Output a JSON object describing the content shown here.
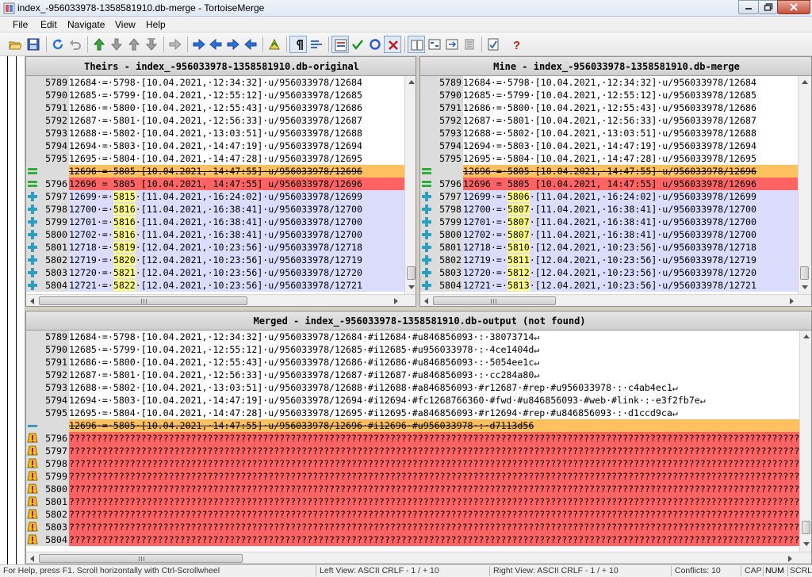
{
  "window": {
    "title": "index_-956033978-1358581910.db-merge - TortoiseMerge"
  },
  "menu": {
    "items": [
      "File",
      "Edit",
      "Navigate",
      "View",
      "Help"
    ]
  },
  "toolbar": {
    "buttons": [
      {
        "name": "open-icon"
      },
      {
        "name": "save-icon"
      },
      {
        "name": "reload-icon"
      },
      {
        "name": "undo-icon"
      },
      {
        "name": "first-difference-icon"
      },
      {
        "name": "next-difference-icon"
      },
      {
        "name": "previous-difference-icon"
      },
      {
        "name": "last-difference-icon"
      },
      {
        "name": "next-inline-difference-icon"
      },
      {
        "name": "next-conflict-icon"
      },
      {
        "name": "previous-conflict-icon"
      },
      {
        "name": "next-edited-icon"
      },
      {
        "name": "previous-edited-icon"
      },
      {
        "name": "filter-icon"
      },
      {
        "name": "whitespace-icon"
      },
      {
        "name": "inline-diff-icon"
      },
      {
        "name": "line-diff-icon"
      },
      {
        "name": "mark-resolved-icon"
      },
      {
        "name": "use-block-icon"
      },
      {
        "name": "reject-icon"
      },
      {
        "name": "one-pane-view-icon"
      },
      {
        "name": "two-pane-view-icon"
      },
      {
        "name": "three-pane-view-icon"
      },
      {
        "name": "collapse-icon"
      },
      {
        "name": "settings-icon"
      },
      {
        "name": "help-icon"
      }
    ]
  },
  "colors": {
    "conflict": "#ff6363",
    "resolved": "#ffc060",
    "added": "#dcdcff",
    "highlight": "#ffff80",
    "linenum_bg": "#dcdcdc"
  },
  "panes": {
    "theirs": {
      "header": "Theirs - index_-956033978-1358581910.db-original",
      "rows": [
        {
          "style": "normal",
          "icon": "",
          "num": "5789",
          "text": "12684·=·5798·[10.04.2021,·12:34:32]·u/956033978/12684"
        },
        {
          "style": "normal",
          "icon": "",
          "num": "5790",
          "text": "12685·=·5799·[10.04.2021,·12:55:12]·u/956033978/12685"
        },
        {
          "style": "normal",
          "icon": "",
          "num": "5791",
          "text": "12686·=·5800·[10.04.2021,·12:55:43]·u/956033978/12686"
        },
        {
          "style": "normal",
          "icon": "",
          "num": "5792",
          "text": "12687·=·5801·[10.04.2021,·12:56:33]·u/956033978/12687"
        },
        {
          "style": "normal",
          "icon": "",
          "num": "5793",
          "text": "12688·=·5802·[10.04.2021,·13:03:51]·u/956033978/12688"
        },
        {
          "style": "normal",
          "icon": "",
          "num": "5794",
          "text": "12694·=·5803·[10.04.2021,·14:47:19]·u/956033978/12694"
        },
        {
          "style": "normal",
          "icon": "",
          "num": "5795",
          "text": "12695·=·5804·[10.04.2021,·14:47:28]·u/956033978/12695"
        },
        {
          "style": "conflict-res",
          "icon": "equal",
          "num": "",
          "text": "12696·=·5805·[10.04.2021,·14:47:55]·u/956033978/12696"
        },
        {
          "style": "conflict",
          "icon": "equal",
          "num": "5796",
          "text": "12696 = 5805 [10.04.2021, 14:47:55] u/956033978/12696"
        },
        {
          "style": "added",
          "icon": "plus",
          "num": "5797",
          "pre": "12699·=·",
          "hl": "5815",
          "post": "·[11.04.2021,·16:24:02]·u/956033978/12699"
        },
        {
          "style": "added",
          "icon": "plus",
          "num": "5798",
          "pre": "12700·=·",
          "hl": "5816",
          "post": "·[11.04.2021,·16:38:41]·u/956033978/12700"
        },
        {
          "style": "added",
          "icon": "plus",
          "num": "5799",
          "pre": "12701·=·",
          "hl": "5816",
          "post": "·[11.04.2021,·16:38:41]·u/956033978/12700"
        },
        {
          "style": "added",
          "icon": "plus",
          "num": "5800",
          "pre": "12702·=·",
          "hl": "5816",
          "post": "·[11.04.2021,·16:38:41]·u/956033978/12700"
        },
        {
          "style": "added",
          "icon": "plus",
          "num": "5801",
          "pre": "12718·=·",
          "hl": "5819",
          "post": "·[12.04.2021,·10:23:56]·u/956033978/12718"
        },
        {
          "style": "added",
          "icon": "plus",
          "num": "5802",
          "pre": "12719·=·",
          "hl": "5820",
          "post": "·[12.04.2021,·10:23:56]·u/956033978/12719"
        },
        {
          "style": "added",
          "icon": "plus",
          "num": "5803",
          "pre": "12720·=·",
          "hl": "5821",
          "post": "·[12.04.2021,·10:23:56]·u/956033978/12720"
        },
        {
          "style": "added",
          "icon": "plus",
          "num": "5804",
          "pre": "12721·=·",
          "hl": "5822",
          "post": "·[12.04.2021,·10:23:56]·u/956033978/12721"
        }
      ]
    },
    "mine": {
      "header": "Mine - index_-956033978-1358581910.db-merge",
      "rows": [
        {
          "style": "normal",
          "icon": "",
          "num": "5789",
          "text": "12684·=·5798·[10.04.2021,·12:34:32]·u/956033978/12684"
        },
        {
          "style": "normal",
          "icon": "",
          "num": "5790",
          "text": "12685·=·5799·[10.04.2021,·12:55:12]·u/956033978/12685"
        },
        {
          "style": "normal",
          "icon": "",
          "num": "5791",
          "text": "12686·=·5800·[10.04.2021,·12:55:43]·u/956033978/12686"
        },
        {
          "style": "normal",
          "icon": "",
          "num": "5792",
          "text": "12687·=·5801·[10.04.2021,·12:56:33]·u/956033978/12687"
        },
        {
          "style": "normal",
          "icon": "",
          "num": "5793",
          "text": "12688·=·5802·[10.04.2021,·13:03:51]·u/956033978/12688"
        },
        {
          "style": "normal",
          "icon": "",
          "num": "5794",
          "text": "12694·=·5803·[10.04.2021,·14:47:19]·u/956033978/12694"
        },
        {
          "style": "normal",
          "icon": "",
          "num": "5795",
          "text": "12695·=·5804·[10.04.2021,·14:47:28]·u/956033978/12695"
        },
        {
          "style": "conflict-res",
          "icon": "equal",
          "num": "",
          "text": "12696·=·5805·[10.04.2021,·14:47:55]·u/956033978/12696"
        },
        {
          "style": "conflict",
          "icon": "equal",
          "num": "5796",
          "text": "12696 = 5805 [10.04.2021, 14:47:55] u/956033978/12696"
        },
        {
          "style": "added",
          "icon": "plus",
          "num": "5797",
          "pre": "12699·=·",
          "hl": "5806",
          "post": "·[11.04.2021,·16:24:02]·u/956033978/12699"
        },
        {
          "style": "added",
          "icon": "plus",
          "num": "5798",
          "pre": "12700·=·",
          "hl": "5807",
          "post": "·[11.04.2021,·16:38:41]·u/956033978/12700"
        },
        {
          "style": "added",
          "icon": "plus",
          "num": "5799",
          "pre": "12701·=·",
          "hl": "5807",
          "post": "·[11.04.2021,·16:38:41]·u/956033978/12700"
        },
        {
          "style": "added",
          "icon": "plus",
          "num": "5800",
          "pre": "12702·=·",
          "hl": "5807",
          "post": "·[11.04.2021,·16:38:41]·u/956033978/12700"
        },
        {
          "style": "added",
          "icon": "plus",
          "num": "5801",
          "pre": "12718·=·",
          "hl": "5810",
          "post": "·[12.04.2021,·10:23:56]·u/956033978/12718"
        },
        {
          "style": "added",
          "icon": "plus",
          "num": "5802",
          "pre": "12719·=·",
          "hl": "5811",
          "post": "·[12.04.2021,·10:23:56]·u/956033978/12719"
        },
        {
          "style": "added",
          "icon": "plus",
          "num": "5803",
          "pre": "12720·=·",
          "hl": "5812",
          "post": "·[12.04.2021,·10:23:56]·u/956033978/12720"
        },
        {
          "style": "added",
          "icon": "plus",
          "num": "5804",
          "pre": "12721·=·",
          "hl": "5813",
          "post": "·[12.04.2021,·10:23:56]·u/956033978/12721"
        }
      ]
    },
    "merged": {
      "header": "Merged - index_-956033978-1358581910.db-output (not found)",
      "rows": [
        {
          "style": "normal",
          "icon": "",
          "num": "5789",
          "text": "12684·=·5798·[10.04.2021,·12:34:32]·u/956033978/12684·#i12684·#u846856093·:·38073714↵"
        },
        {
          "style": "normal",
          "icon": "",
          "num": "5790",
          "text": "12685·=·5799·[10.04.2021,·12:55:12]·u/956033978/12685·#i12685·#u956033978·:·4ce1404d↵"
        },
        {
          "style": "normal",
          "icon": "",
          "num": "5791",
          "text": "12686·=·5800·[10.04.2021,·12:55:43]·u/956033978/12686·#i12686·#u846856093·:·5054ee1c↵"
        },
        {
          "style": "normal",
          "icon": "",
          "num": "5792",
          "text": "12687·=·5801·[10.04.2021,·12:56:33]·u/956033978/12687·#i12687·#u846856093·:·cc284a80↵"
        },
        {
          "style": "normal",
          "icon": "",
          "num": "5793",
          "text": "12688·=·5802·[10.04.2021,·13:03:51]·u/956033978/12688·#i12688·#a846856093·#r12687·#rep·#u956033978·:·c4ab4ec1↵"
        },
        {
          "style": "normal",
          "icon": "",
          "num": "5794",
          "text": "12694·=·5803·[10.04.2021,·14:47:19]·u/956033978/12694·#i12694·#fc1268766360·#fwd·#u846856093·#web·#link·:·e3f2fb7e↵"
        },
        {
          "style": "normal",
          "icon": "",
          "num": "5795",
          "text": "12695·=·5804·[10.04.2021,·14:47:28]·u/956033978/12695·#i12695·#a846856093·#r12694·#rep·#u846856093·:·d1ccd9ca↵"
        },
        {
          "style": "conflict-res",
          "icon": "minus",
          "num": "",
          "text": "12696·=·5805·[10.04.2021,·14:47:55]·u/956033978/12696·#i12696·#u956033978·:·d7113d56"
        },
        {
          "style": "merged-red",
          "icon": "warn",
          "num": "5796",
          "text": "????????????????????????????????????????????????????????????????????????????????????????????????????????????????????????????????????????????"
        },
        {
          "style": "merged-red",
          "icon": "warn",
          "num": "5797",
          "text": "????????????????????????????????????????????????????????????????????????????????????????????????????????????????????????????????????????????"
        },
        {
          "style": "merged-red",
          "icon": "warn",
          "num": "5798",
          "text": "????????????????????????????????????????????????????????????????????????????????????????????????????????????????????????????????????????????"
        },
        {
          "style": "merged-red",
          "icon": "warn",
          "num": "5799",
          "text": "????????????????????????????????????????????????????????????????????????????????????????????????????????????????????????????????????????????"
        },
        {
          "style": "merged-red",
          "icon": "warn",
          "num": "5800",
          "text": "????????????????????????????????????????????????????????????????????????????????????????????????????????????????????????????????????????????"
        },
        {
          "style": "merged-red",
          "icon": "warn",
          "num": "5801",
          "text": "????????????????????????????????????????????????????????????????????????????????????????????????????????????????????????????????????????????"
        },
        {
          "style": "merged-red",
          "icon": "warn",
          "num": "5802",
          "text": "????????????????????????????????????????????????????????????????????????????????????????????????????????????????????????????????????????????"
        },
        {
          "style": "merged-red",
          "icon": "warn",
          "num": "5803",
          "text": "????????????????????????????????????????????????????????????????????????????????????????????????????????????????????????????????????????????"
        },
        {
          "style": "merged-red",
          "icon": "warn",
          "num": "5804",
          "text": "????????????????????????????????????????????????????????????????????????????????????????????????????????????????????????????????????????????"
        }
      ]
    }
  },
  "statusbar": {
    "help": "For Help, press F1. Scroll horizontally with Ctrl-Scrollwheel",
    "left_view": "Left View: ASCII CRLF  - 1 / + 10",
    "right_view": "Right View: ASCII CRLF  - 1 / + 10",
    "conflicts": "Conflicts: 10",
    "cap": "CAP",
    "num": "NUM",
    "scrl": "SCRL"
  }
}
